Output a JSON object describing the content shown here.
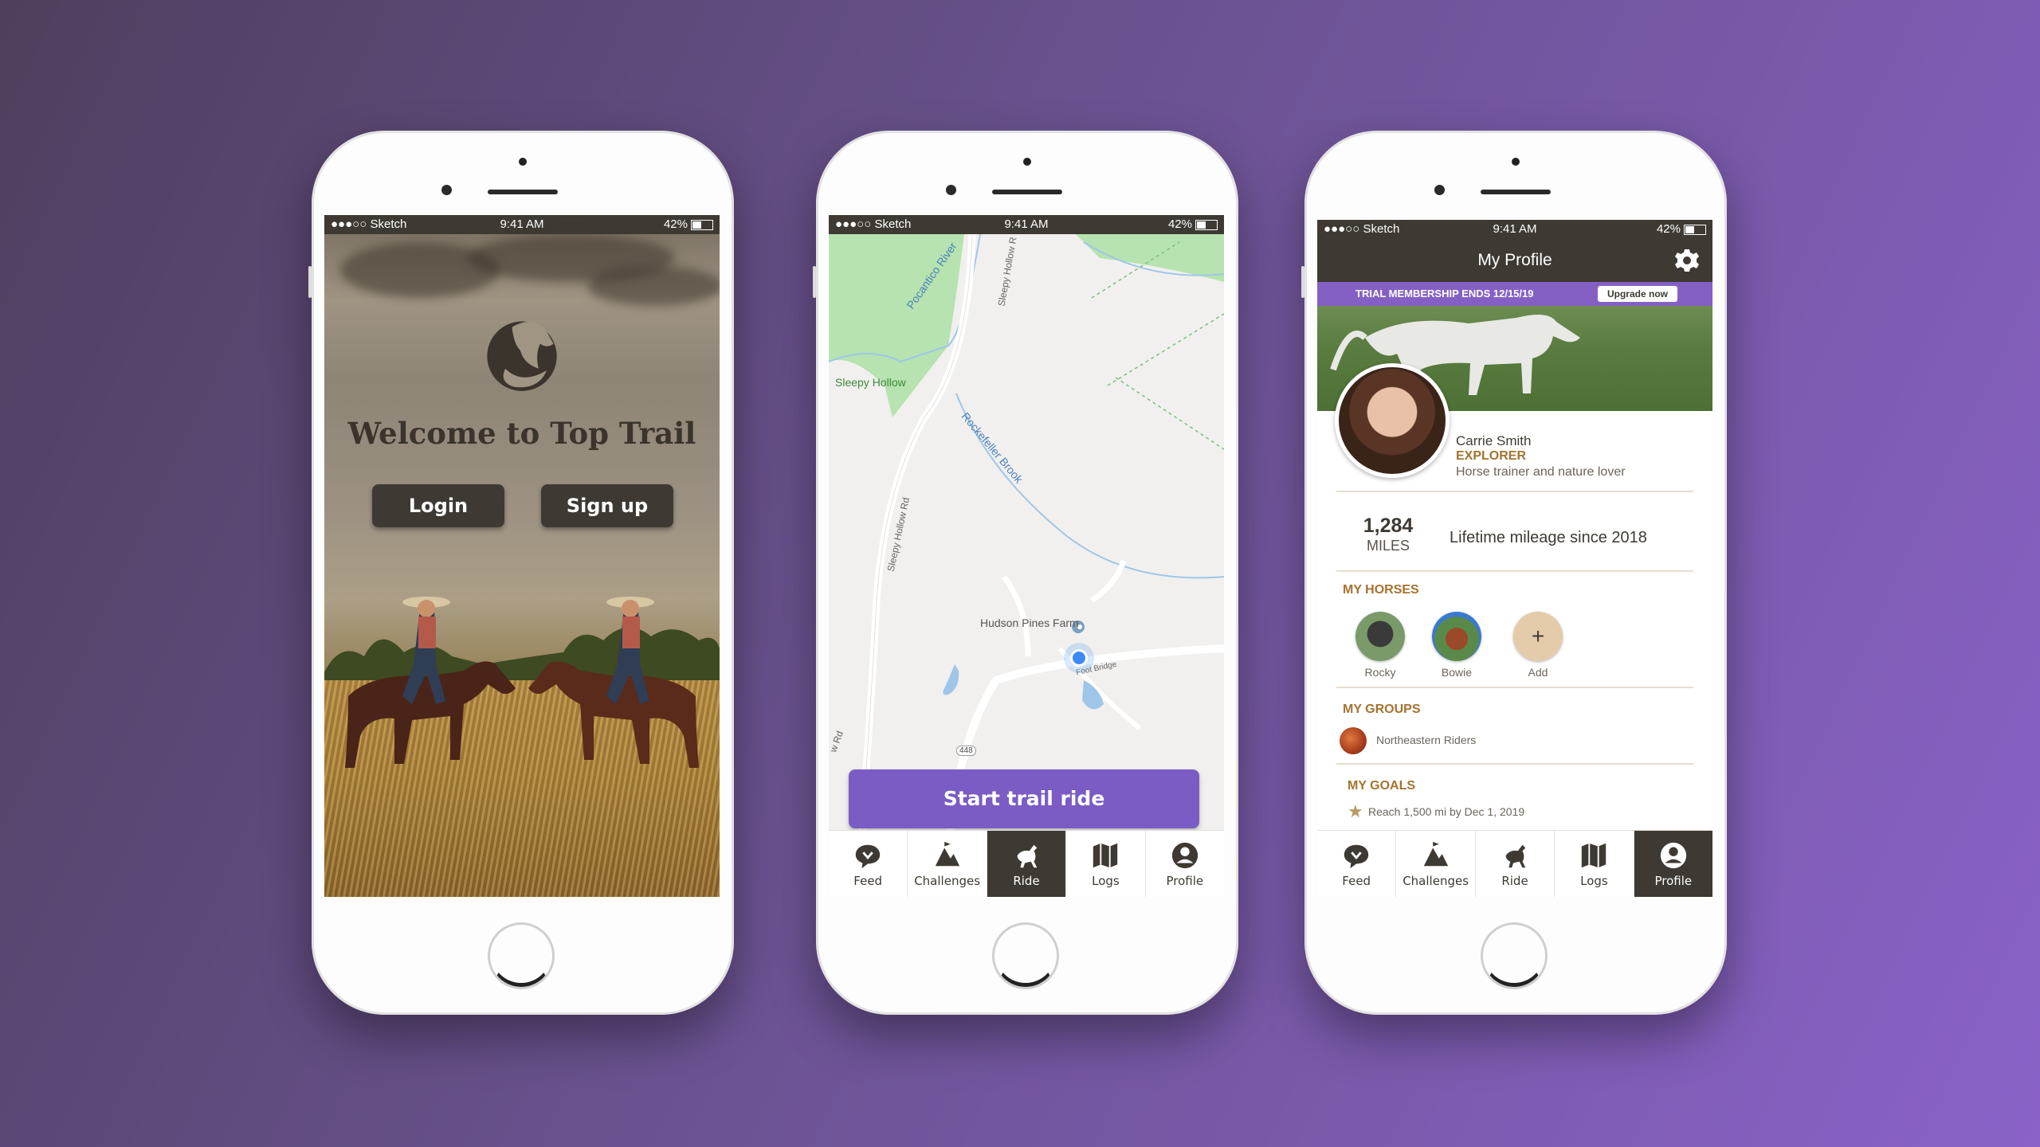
{
  "statusbar": {
    "carrier": "●●●○○ Sketch",
    "time": "9:41 AM",
    "battery": "42%"
  },
  "colors": {
    "accent": "#7a5cc4",
    "dark": "#3e3a33",
    "gold": "#a5722f",
    "background": "#6a5290"
  },
  "welcome": {
    "title": "Welcome to Top Trail",
    "login_label": "Login",
    "signup_label": "Sign up"
  },
  "map": {
    "labels": {
      "pocantico": "Pocantico River",
      "sleepy_hollow": "Sleepy Hollow",
      "rockefeller": "Rockefeller Brook",
      "sleepy_hollow_rd": "Sleepy Hollow Rd",
      "sleepy_hollow_rd2": "Sleepy Hollow R",
      "hudson": "Hudson Pines Farm",
      "footbridge": "Foot Bridge",
      "rd": "w Rd",
      "route": "448"
    },
    "start_label": "Start trail ride"
  },
  "tabs": [
    {
      "label": "Feed",
      "icon": "feed-icon"
    },
    {
      "label": "Challenges",
      "icon": "challenges-icon"
    },
    {
      "label": "Ride",
      "icon": "ride-icon"
    },
    {
      "label": "Logs",
      "icon": "logs-icon"
    },
    {
      "label": "Profile",
      "icon": "profile-icon"
    }
  ],
  "profile": {
    "title": "My Profile",
    "trial_text": "TRIAL MEMBERSHIP ENDS 12/15/19",
    "upgrade_label": "Upgrade now",
    "name": "Carrie Smith",
    "role": "EXPLORER",
    "bio": "Horse trainer and nature lover",
    "miles_value": "1,284",
    "miles_unit": "MILES",
    "lifetime": "Lifetime mileage since 2018",
    "horses_title": "MY HORSES",
    "horses": [
      {
        "name": "Rocky"
      },
      {
        "name": "Bowie"
      },
      {
        "name": "Add"
      }
    ],
    "groups_title": "MY GROUPS",
    "group": "Northeastern Riders",
    "goals_title": "MY GOALS",
    "goal": "Reach 1,500 mi by Dec 1, 2019"
  }
}
